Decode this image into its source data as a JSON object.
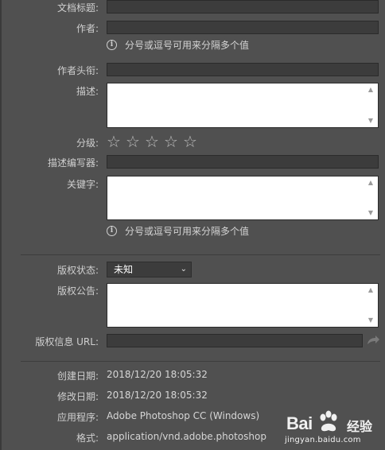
{
  "fields": {
    "doc_title_label": "文档标题:",
    "author_label": "作者:",
    "author_hint": "分号或逗号可用来分隔多个值",
    "author_title_label": "作者头衔:",
    "description_label": "描述:",
    "rating_label": "分级:",
    "rating_value": 0,
    "rating_max": 5,
    "description_writer_label": "描述编写器:",
    "keywords_label": "关键字:",
    "keywords_hint": "分号或逗号可用来分隔多个值"
  },
  "copyright": {
    "status_label": "版权状态:",
    "status_value": "未知",
    "notice_label": "版权公告:",
    "url_label": "版权信息 URL:"
  },
  "info": {
    "created_label": "创建日期:",
    "created_value": "2018/12/20 18:05:32",
    "modified_label": "修改日期:",
    "modified_value": "2018/12/20 18:05:32",
    "app_label": "应用程序:",
    "app_value": "Adobe Photoshop CC (Windows)",
    "format_label": "格式:",
    "format_value": "application/vnd.adobe.photoshop"
  },
  "watermark": {
    "brand": "Bai",
    "cn": "经验",
    "url": "jingyan.baidu.com"
  },
  "icons": {
    "info": "info-circle-icon",
    "star": "star-outline-icon",
    "share": "share-arrow-icon",
    "chevron": "chevron-down-icon"
  }
}
